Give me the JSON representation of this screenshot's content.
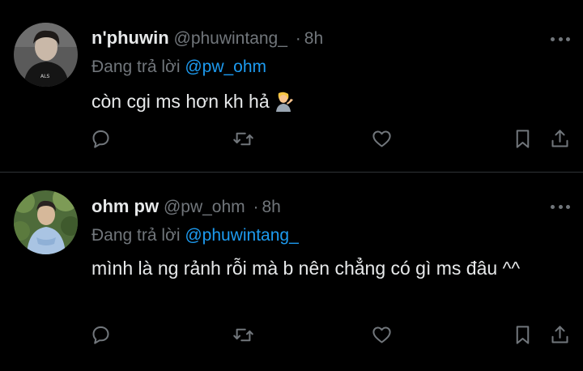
{
  "tweets": [
    {
      "display_name": "n'phuwin",
      "handle": "@phuwintang_",
      "separator": "·",
      "time": "8h",
      "reply_prefix": "Đang trả lời",
      "reply_mention": "@pw_ohm",
      "text": "còn cgi ms hơn kh hả",
      "emoji": "person-tipping-hand-emoji"
    },
    {
      "display_name": "ohm pw",
      "handle": "@pw_ohm",
      "separator": "·",
      "time": "8h",
      "reply_prefix": "Đang trả lời",
      "reply_mention": "@phuwintang_",
      "text": "mình là ng rảnh rỗi mà b nên chẳng có gì ms đâu ^^"
    }
  ],
  "actions": [
    "reply-icon",
    "retweet-icon",
    "like-icon",
    "bookmark-icon",
    "share-icon"
  ],
  "colors": {
    "background": "#000000",
    "text": "#e7e9ea",
    "secondary": "#71767b",
    "mention": "#1d9bf0",
    "divider": "#2f3336"
  }
}
